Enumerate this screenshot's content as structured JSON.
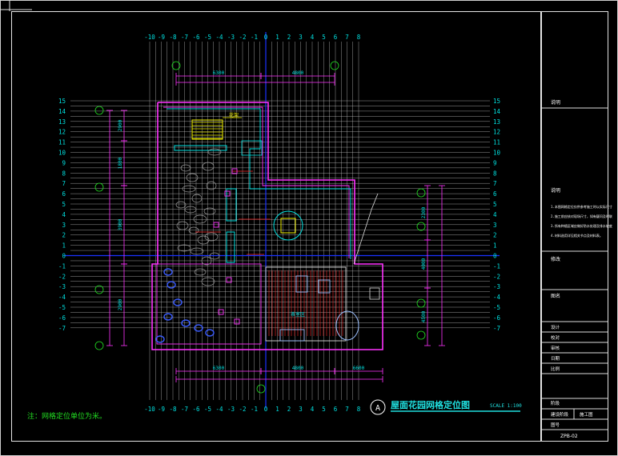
{
  "drawing": {
    "x_axis_numbers": [
      "-10",
      "-9",
      "-8",
      "-7",
      "-6",
      "-5",
      "-4",
      "-3",
      "-2",
      "-1",
      "0",
      "1",
      "2",
      "3",
      "4",
      "5",
      "6",
      "7",
      "8"
    ],
    "y_axis_numbers": [
      "15",
      "14",
      "13",
      "12",
      "11",
      "10",
      "9",
      "8",
      "7",
      "6",
      "5",
      "4",
      "3",
      "2",
      "1",
      "0",
      "-1",
      "-2",
      "-3",
      "-4",
      "-5",
      "-6",
      "-7"
    ],
    "top_dims": [
      "6300",
      "4800"
    ],
    "bottom_dims": [
      "6300",
      "4800",
      "6600"
    ],
    "left_dims": [
      "2900",
      "1800",
      "3900",
      "2900"
    ],
    "right_dims": [
      "2300",
      "4000",
      "4500"
    ],
    "room_label": "花架",
    "room_label_2": "茶室区"
  },
  "title": {
    "text": "屋面花园网格定位图",
    "scale": "SCALE 1:100",
    "note": "注：网格定位单位为米。",
    "north": "A"
  },
  "title_block": {
    "row1": "说明",
    "notes": [
      "1.本图网格定位仅供参考施工时以实际尺寸为准。",
      "2.施工前应核对现场尺寸，如有疑问及时联系。",
      "3.所有种植区域应做好防水处理及排水坡度，坡度不小于1%。",
      "4.材料选用详见相关节点及材料表。"
    ],
    "row2": "修改",
    "row3": "图名",
    "label_a": "设计",
    "label_b": "校对",
    "label_c": "审核",
    "label_d": "日期",
    "label_e": "比例",
    "stage_label": "阶段",
    "stage": "施工图",
    "drawing_no_label": "图号",
    "drawing_no": "ZPB-02"
  },
  "colors": {
    "grid": "#d8d8d8",
    "axis": "#1a33ff",
    "cyan": "#00e0e0",
    "magenta": "#ff33ff",
    "yellow": "#f0f000",
    "red": "#ff2a2a",
    "green": "#22dd22",
    "white": "#ffffff"
  }
}
